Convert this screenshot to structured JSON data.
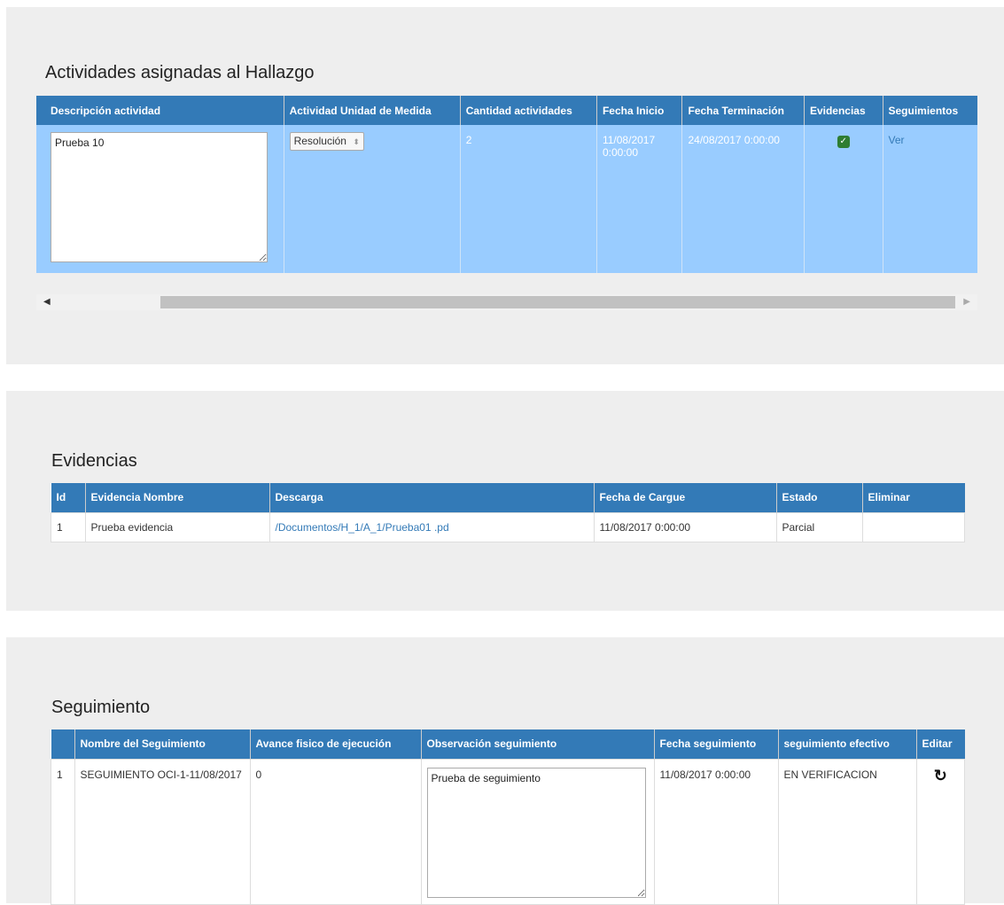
{
  "actividades": {
    "title": "Actividades asignadas al Hallazgo",
    "headers": [
      "Descripción actividad",
      "Actividad Unidad de Medida",
      "Cantidad actividades",
      "Fecha Inicio",
      "Fecha Terminación",
      "Evidencias",
      "Seguimientos"
    ],
    "row": {
      "descripcion": "Prueba 10",
      "unidad": "Resolución",
      "cantidad": "2",
      "fecha_inicio": "11/08/2017 0:00:00",
      "fecha_terminacion": "24/08/2017 0:00:00",
      "evidencias_icon": "check-circle-icon",
      "seguimientos_link": "Ver"
    },
    "colors": {
      "header": "#337ab7",
      "selected_row": "#99ccff"
    }
  },
  "evidencias": {
    "title": "Evidencias",
    "headers": [
      "Id",
      "Evidencia Nombre",
      "Descarga",
      "Fecha de Cargue",
      "Estado",
      "Eliminar"
    ],
    "rows": [
      {
        "id": "1",
        "nombre": "Prueba evidencia",
        "descarga": "/Documentos/H_1/A_1/Prueba01 .pd",
        "fecha": "11/08/2017 0:00:00",
        "estado": "Parcial",
        "eliminar": ""
      }
    ]
  },
  "seguimiento": {
    "title": "Seguimiento",
    "headers": [
      "",
      "Nombre del Seguimiento",
      "Avance fisico de ejecución",
      "Observación seguimiento",
      "Fecha seguimiento",
      "seguimiento efectivo",
      "Editar"
    ],
    "rows": [
      {
        "num": "1",
        "nombre": "SEGUIMIENTO OCI-1-11/08/2017",
        "avance": "0",
        "observacion": "Prueba de seguimiento",
        "fecha": "11/08/2017 0:00:00",
        "efectivo": "EN VERIFICACION",
        "editar_icon": "refresh-icon"
      }
    ]
  }
}
